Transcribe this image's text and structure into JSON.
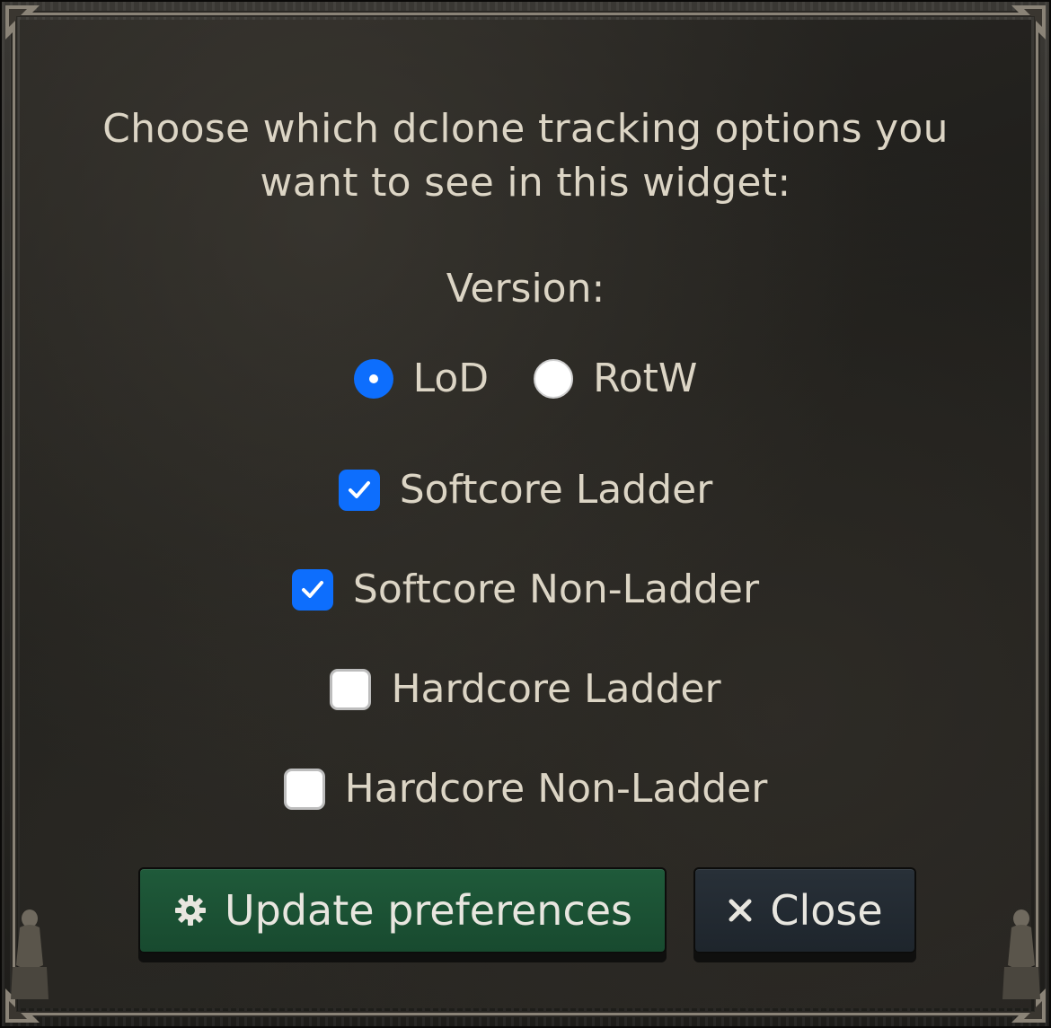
{
  "prompt": {
    "line1": "Choose which dclone tracking options you",
    "line2": "want to see in this widget:"
  },
  "version": {
    "label": "Version:",
    "options": [
      {
        "label": "LoD",
        "selected": true
      },
      {
        "label": "RotW",
        "selected": false
      }
    ]
  },
  "modes": [
    {
      "label": "Softcore Ladder",
      "checked": true
    },
    {
      "label": "Softcore Non-Ladder",
      "checked": true
    },
    {
      "label": "Hardcore Ladder",
      "checked": false
    },
    {
      "label": "Hardcore Non-Ladder",
      "checked": false
    }
  ],
  "buttons": {
    "update": {
      "label": "Update preferences",
      "icon": "gear-icon"
    },
    "close": {
      "label": "Close",
      "icon": "close-icon"
    }
  },
  "colors": {
    "accent": "#0d6efd",
    "update_button": "#1f5a3a",
    "close_button": "#283038",
    "text": "#dcd5c5"
  }
}
